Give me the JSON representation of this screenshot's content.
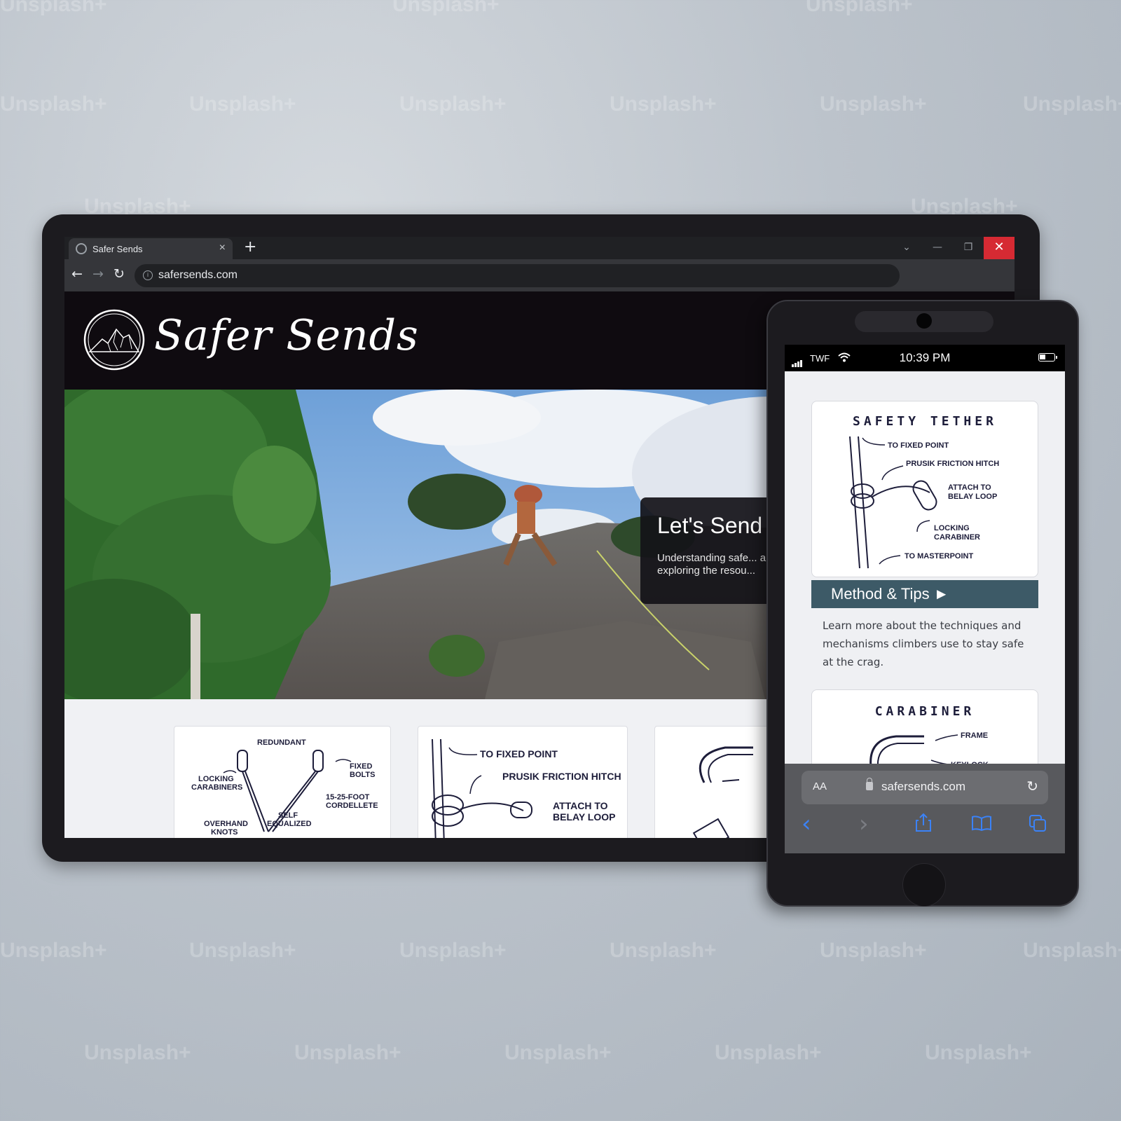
{
  "watermark": "Unsplash+",
  "desktop": {
    "tab": {
      "title": "Safer Sends",
      "close": "×"
    },
    "new_tab": "+",
    "window": {
      "dropdown": "⌄",
      "minimize": "—",
      "restore": "❐",
      "close": "✕"
    },
    "nav": {
      "back": "←",
      "forward": "→",
      "reload": "↻"
    },
    "address": "safersends.com",
    "site_title": "Safer Sends",
    "hero": {
      "heading": "Let's Send",
      "text": "Understanding safe... any big adventure. exploring the resou..."
    },
    "cards": [
      {
        "labels": [
          "REDUNDANT",
          "LOCKING",
          "CARABINERS",
          "FIXED",
          "BOLTS",
          "15-25-FOOT",
          "CORDELLETE",
          "SELF",
          "EQUALIZED",
          "OVERHAND",
          "KNOTS"
        ]
      },
      {
        "labels": [
          "TO FIXED POINT",
          "PRUSIK FRICTION HITCH",
          "ATTACH TO",
          "BELAY LOOP"
        ]
      }
    ]
  },
  "mobile": {
    "status": {
      "carrier": "TWF",
      "time": "10:39 PM"
    },
    "safety_card": {
      "title": "SAFETY TETHER",
      "labels": [
        "TO FIXED POINT",
        "PRUSIK FRICTION HITCH",
        "ATTACH TO",
        "BELAY LOOP",
        "LOCKING",
        "CARABINER",
        "TO MASTERPOINT"
      ]
    },
    "method": {
      "label": "Method & Tips ►",
      "description": "Learn more about the techniques and mechanisms climbers use to stay safe at the crag."
    },
    "carabiner_card": {
      "title": "CARABINER",
      "labels": [
        "FRAME",
        "KEYLOCK"
      ]
    },
    "safari": {
      "aa": "AA",
      "url": "safersends.com",
      "reload": "↻",
      "back": "‹",
      "forward": "›"
    }
  },
  "colors": {
    "header_bg": "#0f0b10",
    "method_bar": "#3d5a67",
    "chrome_close": "#d62a33",
    "safari_blue": "#3b82f6"
  }
}
